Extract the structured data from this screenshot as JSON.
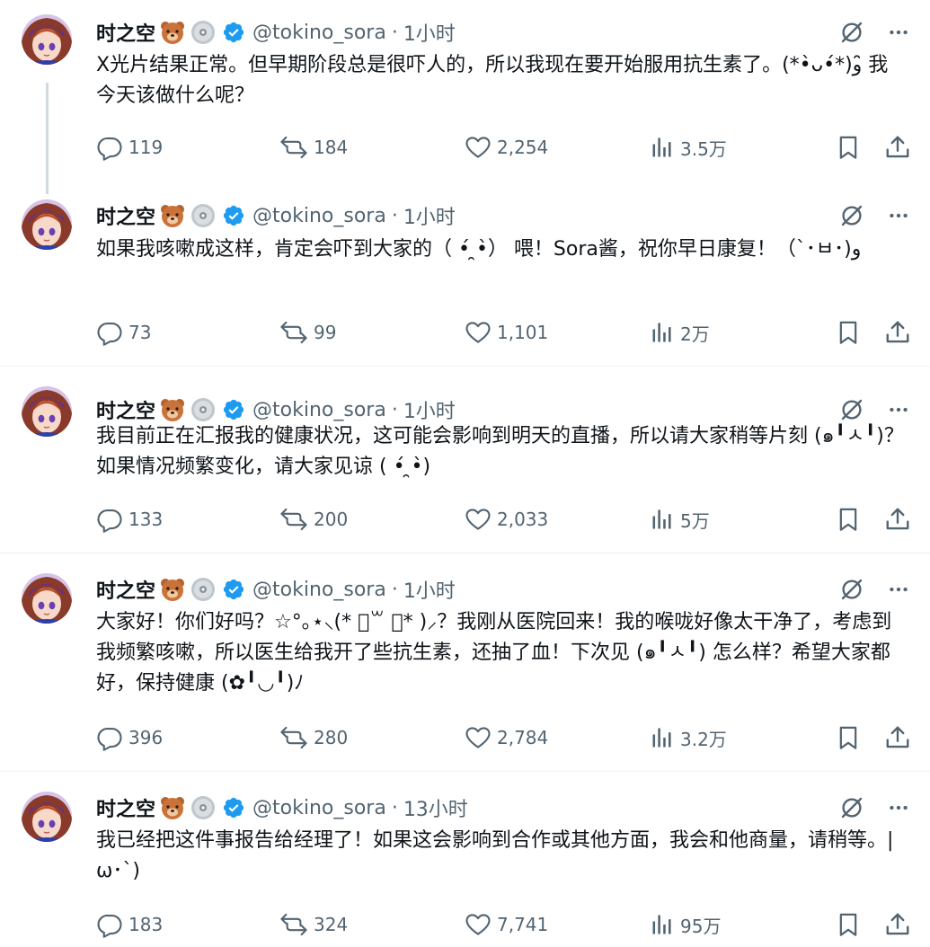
{
  "author": {
    "name": "时之空",
    "handle": "@tokino_sora"
  },
  "icons": {
    "reply": "reply-icon",
    "retweet": "retweet-icon",
    "like": "heart-icon",
    "views": "views-icon",
    "bookmark": "bookmark-icon",
    "share": "share-icon",
    "grok": "grok-icon",
    "more": "more-icon",
    "verified": "verified-badge-icon",
    "accent_color": "#1d9bf0",
    "text_secondary": "#536471"
  },
  "tweets": [
    {
      "time": "1小时",
      "text": "X光片结果正常。但早期阶段总是很吓人的，所以我现在要开始服用抗生素了。(*•̀ᴗ•́*)و ̑̑我今天该做什么呢？",
      "replies": "119",
      "retweets": "184",
      "likes": "2,254",
      "views": "3.5万"
    },
    {
      "time": "1小时",
      "text": "如果我咳嗽成这样，肯定会吓到大家的（ •́ ̯•̀） 喂！Sora酱，祝你早日康复！（`･ㅂ･)و",
      "replies": "73",
      "retweets": "99",
      "likes": "1,101",
      "views": "2万"
    },
    {
      "time": "1小时",
      "text": "我目前正在汇报我的健康状况，这可能会影响到明天的直播，所以请大家稍等片刻 (๑╹ㅅ╹)？如果情况频繁变化，请大家见谅 ( •́ ̯•̀)",
      "replies": "133",
      "retweets": "200",
      "likes": "2,033",
      "views": "5万"
    },
    {
      "time": "1小时",
      "text": "大家好！你们好吗？☆°｡⋆⸜(* ॑꒳ ॑* )⸝？我刚从医院回来！我的喉咙好像太干净了，考虑到我频繁咳嗽，所以医生给我开了些抗生素，还抽了血！下次见 (๑╹ㅅ╹) 怎么样？希望大家都好，保持健康 (✿╹◡╹)ﾉ",
      "replies": "396",
      "retweets": "280",
      "likes": "2,784",
      "views": "3.2万"
    },
    {
      "time": "13小时",
      "text": "我已经把这件事报告给经理了！如果这会影响到合作或其他方面，我会和他商量，请稍等。|ω･`)",
      "replies": "183",
      "retweets": "324",
      "likes": "7,741",
      "views": "95万"
    }
  ]
}
